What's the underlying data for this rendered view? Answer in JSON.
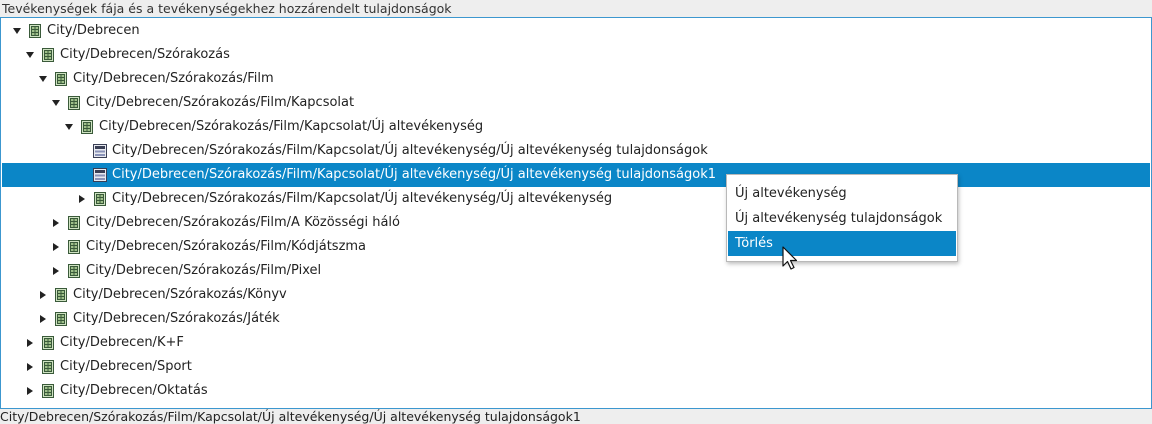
{
  "panel_title": "Tevékenységek fája és a tevékenységekhez hozzárendelt tulajdonságok",
  "tree": [
    {
      "label": "City/Debrecen",
      "state": "expanded",
      "icon": "folder-node-icon"
    },
    {
      "label": "City/Debrecen/Szórakozás",
      "state": "expanded",
      "icon": "folder-node-icon"
    },
    {
      "label": "City/Debrecen/Szórakozás/Film",
      "state": "expanded",
      "icon": "folder-node-icon"
    },
    {
      "label": "City/Debrecen/Szórakozás/Film/Kapcsolat",
      "state": "expanded",
      "icon": "folder-node-icon"
    },
    {
      "label": "City/Debrecen/Szórakozás/Film/Kapcsolat/Új altevékenység",
      "state": "expanded",
      "icon": "folder-node-icon"
    },
    {
      "label": "City/Debrecen/Szórakozás/Film/Kapcsolat/Új altevékenység/Új altevékenység tulajdonságok",
      "state": "leaf",
      "icon": "property-node-icon"
    },
    {
      "label": "City/Debrecen/Szórakozás/Film/Kapcsolat/Új altevékenység/Új altevékenység tulajdonságok1",
      "state": "leaf",
      "icon": "property-node-icon",
      "selected": true
    },
    {
      "label": "City/Debrecen/Szórakozás/Film/Kapcsolat/Új altevékenység/Új altevékenység",
      "state": "collapsed",
      "icon": "folder-node-icon"
    },
    {
      "label": "City/Debrecen/Szórakozás/Film/A Közösségi háló",
      "state": "collapsed",
      "icon": "folder-node-icon"
    },
    {
      "label": "City/Debrecen/Szórakozás/Film/Kódjátszma",
      "state": "collapsed",
      "icon": "folder-node-icon"
    },
    {
      "label": "City/Debrecen/Szórakozás/Film/Pixel",
      "state": "collapsed",
      "icon": "folder-node-icon"
    },
    {
      "label": "City/Debrecen/Szórakozás/Könyv",
      "state": "collapsed",
      "icon": "folder-node-icon"
    },
    {
      "label": "City/Debrecen/Szórakozás/Játék",
      "state": "collapsed",
      "icon": "folder-node-icon"
    },
    {
      "label": "City/Debrecen/K+F",
      "state": "collapsed",
      "icon": "folder-node-icon"
    },
    {
      "label": "City/Debrecen/Sport",
      "state": "collapsed",
      "icon": "folder-node-icon"
    },
    {
      "label": "City/Debrecen/Oktatás",
      "state": "collapsed",
      "icon": "folder-node-icon"
    }
  ],
  "context_menu": {
    "items": [
      {
        "label": "Új altevékenység"
      },
      {
        "label": "Új altevékenység tulajdonságok"
      },
      {
        "label": "Törlés",
        "active": true
      }
    ]
  },
  "status_text": "City/Debrecen/Szórakozás/Film/Kapcsolat/Új altevékenység/Új altevékenység tulajdonságok1",
  "colors": {
    "selection": "#0b86c7",
    "border": "#3c97cf",
    "background": "#eeeeee"
  }
}
